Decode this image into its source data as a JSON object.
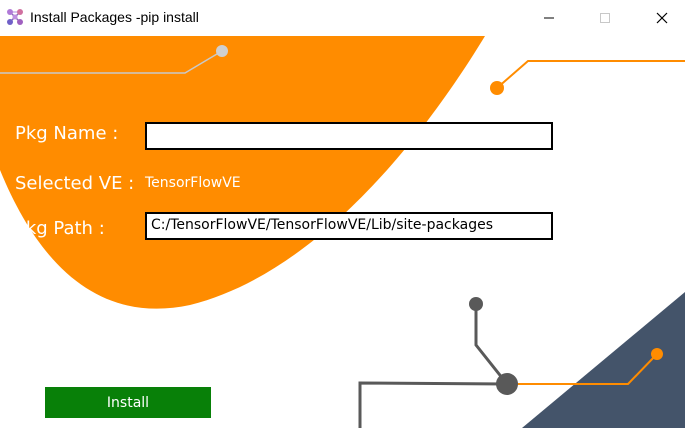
{
  "window": {
    "title": "Install Packages -pip install",
    "icon": "network-nodes-icon"
  },
  "form": {
    "pkg_name_label": "Pkg Name :",
    "pkg_name_value": "",
    "selected_ve_label": "Selected VE :",
    "selected_ve_value": "TensorFlowVE",
    "pkg_path_label": "Pkg Path :",
    "pkg_path_value": "C:/TensorFlowVE/TensorFlowVE/Lib/site-packages"
  },
  "actions": {
    "install_label": "Install"
  },
  "colors": {
    "accent_orange": "#FF8C00",
    "slate": "#44546A",
    "install_green": "#088008",
    "circuit_gray": "#595959"
  }
}
